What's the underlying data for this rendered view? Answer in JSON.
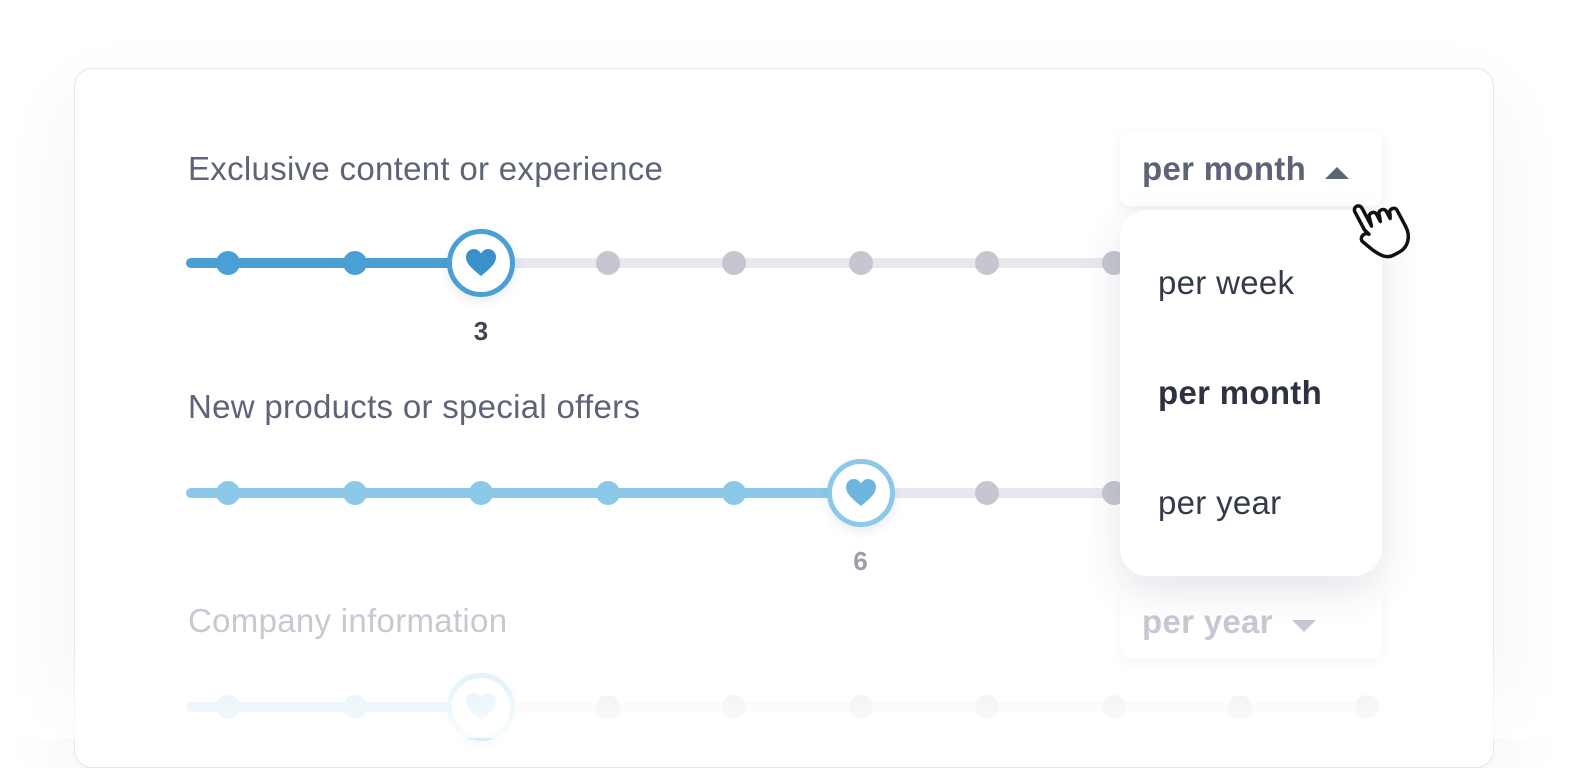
{
  "colors": {
    "accent_primary": "#4a9fd4",
    "accent_secondary": "#8cc8e8",
    "track": "#e8e8ee",
    "dot_inactive": "#c5c6cf",
    "text_label": "#5d6478",
    "text_faded": "#c7c9d2"
  },
  "rows": [
    {
      "label": "Exclusive content or experience",
      "value": "3",
      "value_num": 3,
      "max": 10,
      "unit": "per month",
      "unit_open": true
    },
    {
      "label": "New products or special offers",
      "value": "6",
      "value_num": 6,
      "max": 10,
      "unit": "per month"
    },
    {
      "label": "Company information",
      "value_num": 3,
      "max": 10,
      "unit": "per year"
    }
  ],
  "dropdown": {
    "options": [
      {
        "label": "per week"
      },
      {
        "label": "per month",
        "selected": true
      },
      {
        "label": "per year"
      }
    ]
  },
  "icons": {
    "thumb": "heart-icon",
    "caret_up": "caret-up-icon",
    "caret_down": "caret-down-icon",
    "cursor": "hand-pointer-icon"
  }
}
